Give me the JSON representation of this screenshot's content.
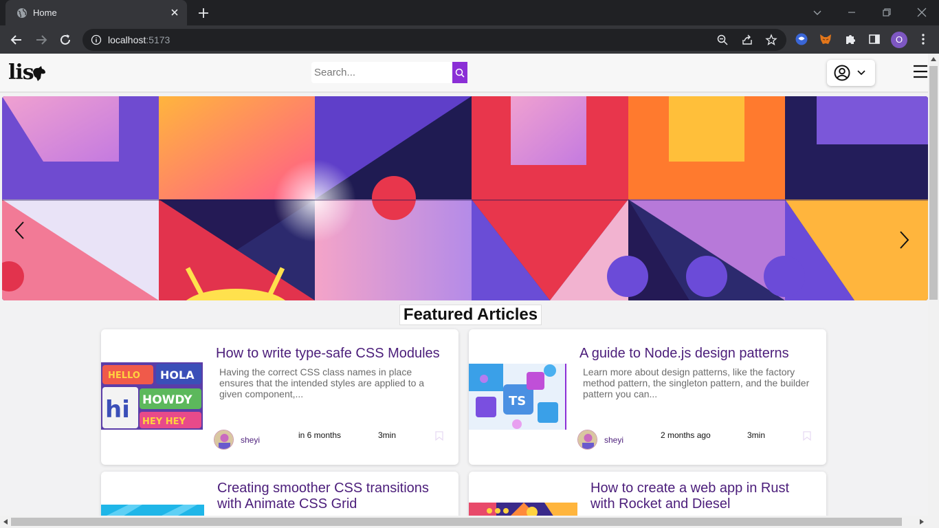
{
  "browser": {
    "tab_title": "Home",
    "url_host": "localhost",
    "url_port": ":5173",
    "profile_initial": "O"
  },
  "header": {
    "logo_text": "lis",
    "search_placeholder": "Search..."
  },
  "featured": {
    "title": "Featured Articles",
    "cards": [
      {
        "title": "How to write type-safe CSS Modules",
        "excerpt": "Having the correct CSS class names in place ensures that the intended styles are applied to a given component,...",
        "author": "sheyi",
        "date": "in 6 months",
        "read_time": "3min",
        "thumb_words": [
          "HELLO",
          "HOLA",
          "hi",
          "HOWDY",
          "HEY HEY"
        ]
      },
      {
        "title": "A guide to Node.js design patterns",
        "excerpt": "Learn more about design patterns, like the factory method pattern, the singleton pattern, and the builder pattern you can...",
        "author": "sheyi",
        "date": "2 months ago",
        "read_time": "3min",
        "thumb_words": [
          "TS"
        ]
      },
      {
        "title": "Creating smoother CSS transitions with Animate CSS Grid"
      },
      {
        "title": "How to create a web app in Rust with Rocket and Diesel"
      }
    ]
  },
  "colors": {
    "accent": "#8b2fd6",
    "title_purple": "#4b1d7a"
  }
}
